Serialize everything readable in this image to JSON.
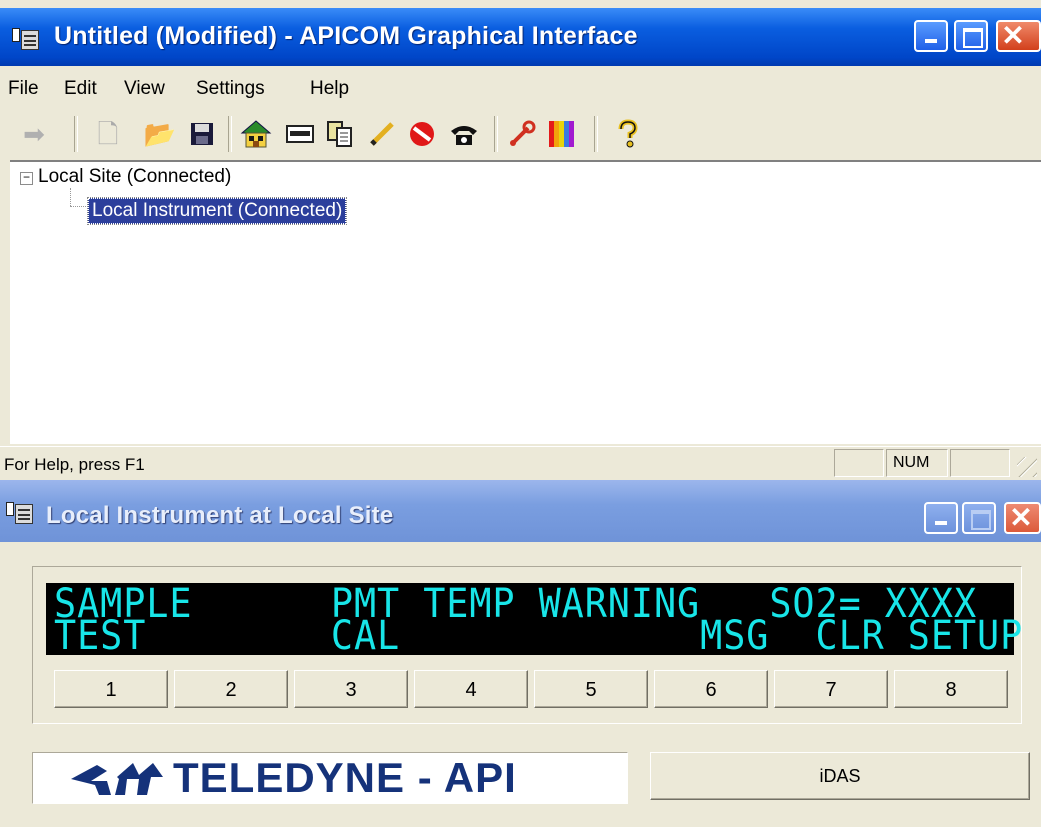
{
  "main_window": {
    "title": "Untitled (Modified) - APICOM Graphical Interface",
    "menu": [
      "File",
      "Edit",
      "View",
      "Settings",
      "Help"
    ],
    "toolbar_icons": [
      "arrow-right-icon",
      "new-file-icon",
      "open-folder-icon",
      "save-icon",
      "site-house-icon",
      "keypad-icon",
      "copy-icon",
      "edit-pencil-icon",
      "stop-icon",
      "phone-icon",
      "wrench-icon",
      "color-bars-icon",
      "help-icon"
    ],
    "tree": {
      "expander": "−",
      "root": "Local Site (Connected)",
      "child": "Local Instrument (Connected)"
    },
    "status": {
      "help_text": "For Help, press F1",
      "num_indicator": "NUM"
    }
  },
  "instrument_window": {
    "title": "Local Instrument at Local Site",
    "display": {
      "line1": "SAMPLE      PMT TEMP WARNING   SO2= XXXX",
      "line2": "TEST        CAL             MSG  CLR SETUP"
    },
    "keys": [
      "1",
      "2",
      "3",
      "4",
      "5",
      "6",
      "7",
      "8"
    ],
    "logo_text": "TELEDYNE - API",
    "idas_button": "iDAS"
  },
  "colors": {
    "title_active": "#0a5ee0",
    "title_inactive": "#7a9ee0",
    "lcd_text": "#18e5e8",
    "selection": "#2c3f9c",
    "logo": "#15327a"
  }
}
